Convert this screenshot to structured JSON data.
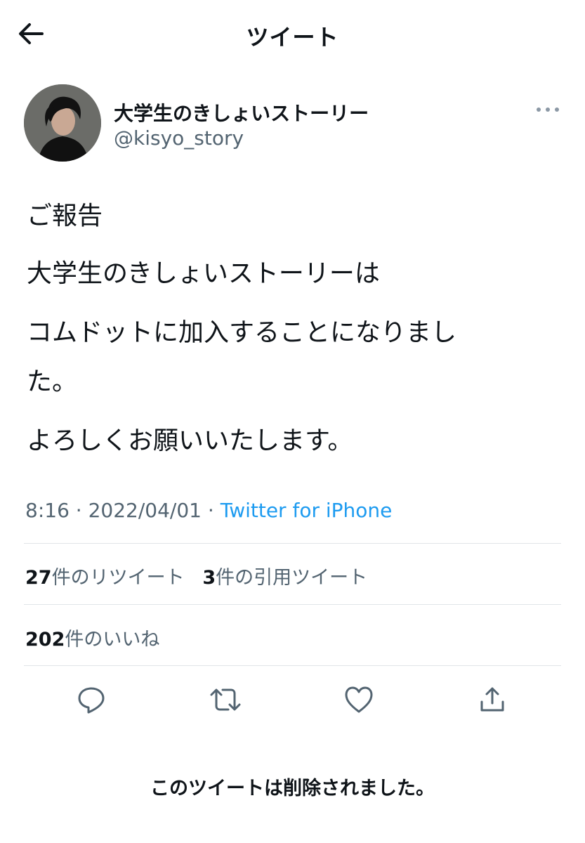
{
  "header": {
    "title": "ツイート",
    "back_icon": "arrow-left-icon"
  },
  "author": {
    "display_name": "大学生のきしょいストーリー",
    "handle": "@kisyo_story",
    "more_icon": "more-dots-icon"
  },
  "tweet": {
    "lines": [
      "ご報告",
      "大学生のきしょいストーリーは",
      "コムドットに加入することになりまし",
      "た。",
      "よろしくお願いいたします。"
    ],
    "time": "8:16",
    "separator": "·",
    "date": "2022/04/01",
    "source": "Twitter for iPhone"
  },
  "stats": {
    "retweets_count": "27",
    "retweets_label": "件のリツイート",
    "quotes_count": "3",
    "quotes_label": "件の引用ツイート",
    "likes_count": "202",
    "likes_label": "件のいいね"
  },
  "actions": [
    "reply-icon",
    "retweet-icon",
    "like-icon",
    "share-icon"
  ],
  "footer": {
    "deleted_notice": "このツイートは削除されました。"
  },
  "colors": {
    "text": "#0f1419",
    "secondary": "#536471",
    "link": "#1d9bf0",
    "divider": "#e1e5e8"
  }
}
